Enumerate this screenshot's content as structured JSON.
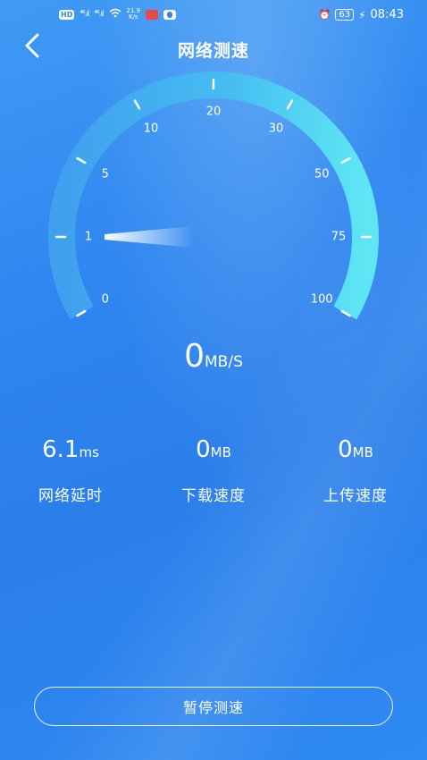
{
  "status_bar": {
    "hd_label": "HD",
    "signal1": "⁴⁶.ıl",
    "signal2": "⁴⁶.ıl",
    "net_speed_value": "21.9",
    "net_speed_unit": "K/s",
    "battery": "63",
    "time": "08:43"
  },
  "header": {
    "title": "网络测速"
  },
  "gauge": {
    "ticks": [
      "0",
      "1",
      "5",
      "10",
      "20",
      "30",
      "50",
      "75",
      "100"
    ],
    "needle_value": 1,
    "fill_fraction": 1.0
  },
  "speed": {
    "value": "0",
    "unit": "MB/S"
  },
  "stats": [
    {
      "value": "6.1",
      "unit": "ms",
      "label": "网络延时"
    },
    {
      "value": "0",
      "unit": "MB",
      "label": "下载速度"
    },
    {
      "value": "0",
      "unit": "MB",
      "label": "上传速度"
    }
  ],
  "actions": {
    "pause_label": "暂停测速"
  },
  "colors": {
    "background": "#2f86f0",
    "arc_start": "#3fa6ef",
    "arc_end": "#5de6f3"
  }
}
